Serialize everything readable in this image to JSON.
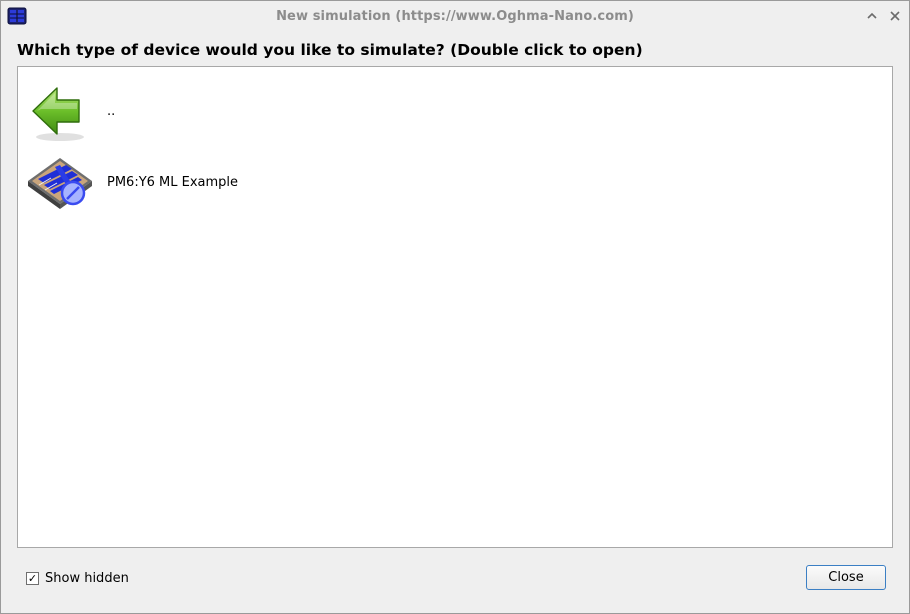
{
  "window": {
    "title": "New simulation (https://www.Oghma-Nano.com)",
    "app_icon": "solar-cell-app-icon",
    "controls": {
      "collapse_icon": "chevron-up-icon",
      "close_icon": "close-icon"
    }
  },
  "prompt": "Which type of device would you like to simulate? (Double click to open)",
  "items": [
    {
      "label": "..",
      "icon": "back-arrow-icon",
      "icon_color": "#5fb021"
    },
    {
      "label": "PM6:Y6 ML Example",
      "icon": "device-simulation-icon",
      "icon_color": "#1f2fd6"
    }
  ],
  "footer": {
    "show_hidden_label": "Show hidden",
    "show_hidden_checked": true,
    "checkmark": "✓",
    "close_label": "Close"
  },
  "colors": {
    "accent": "#3b7fc4",
    "window_bg": "#efefef",
    "list_bg": "#ffffff"
  }
}
